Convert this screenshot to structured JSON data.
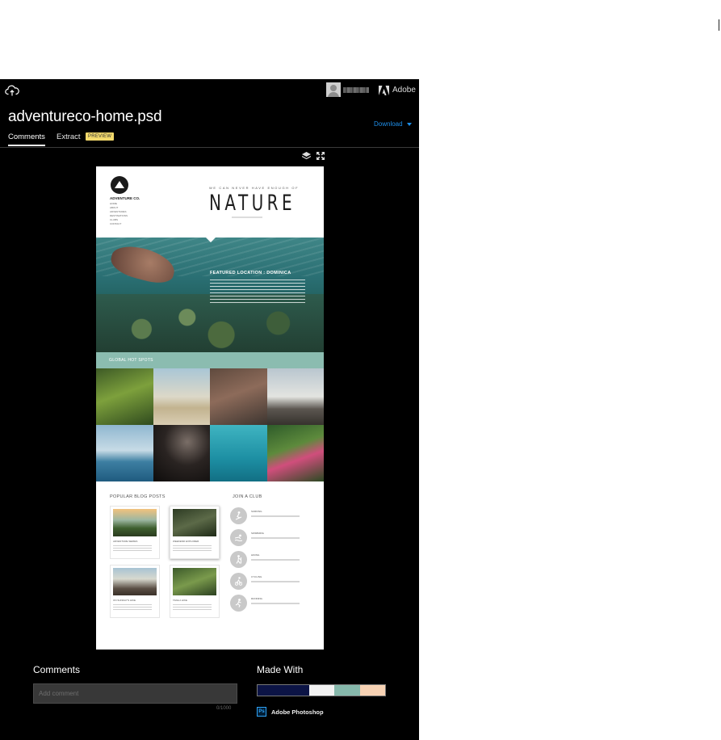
{
  "app": {
    "brand_label": "Adobe",
    "file_title": "adventureco-home.psd",
    "download_label": "Download"
  },
  "tabs": [
    {
      "label": "Comments",
      "active": true
    },
    {
      "label": "Extract",
      "active": false,
      "badge": "PREVIEW"
    }
  ],
  "artboard": {
    "logo_name": "ADVENTURE CO.",
    "nav": [
      "Home",
      "About",
      "Adventures",
      "Destinations",
      "Clubs",
      "Contact"
    ],
    "tagline": "WE CAN NEVER HAVE ENOUGH OF",
    "headline": "NATURE",
    "featured_title": "FEATURED LOCATION : DOMINICA",
    "hotspots_label": "GLOBAL HOT SPOTS",
    "blog_title": "POPULAR BLOG POSTS",
    "club_title": "JOIN A CLUB",
    "posts": [
      {
        "caption": "Adventure Series"
      },
      {
        "caption": "Weekend Explorer"
      },
      {
        "caption": "On Sunday's Hike"
      },
      {
        "caption": "Take a Hike"
      }
    ],
    "clubs": [
      {
        "name": "Surfing"
      },
      {
        "name": "Swimming"
      },
      {
        "name": "Hiking"
      },
      {
        "name": "Cycling"
      },
      {
        "name": "Running"
      }
    ]
  },
  "comments": {
    "heading": "Comments",
    "placeholder": "Add comment",
    "char_count": "0/1000"
  },
  "made_with": {
    "heading": "Made With",
    "swatches": [
      "#0c1445",
      "#f2f2f2",
      "#86b8ab",
      "#f7d2b4"
    ],
    "app_name": "Adobe Photoshop"
  },
  "colors": {
    "background": "#000000",
    "accent": "#1e8ee8",
    "badge": "#f3d96b"
  }
}
